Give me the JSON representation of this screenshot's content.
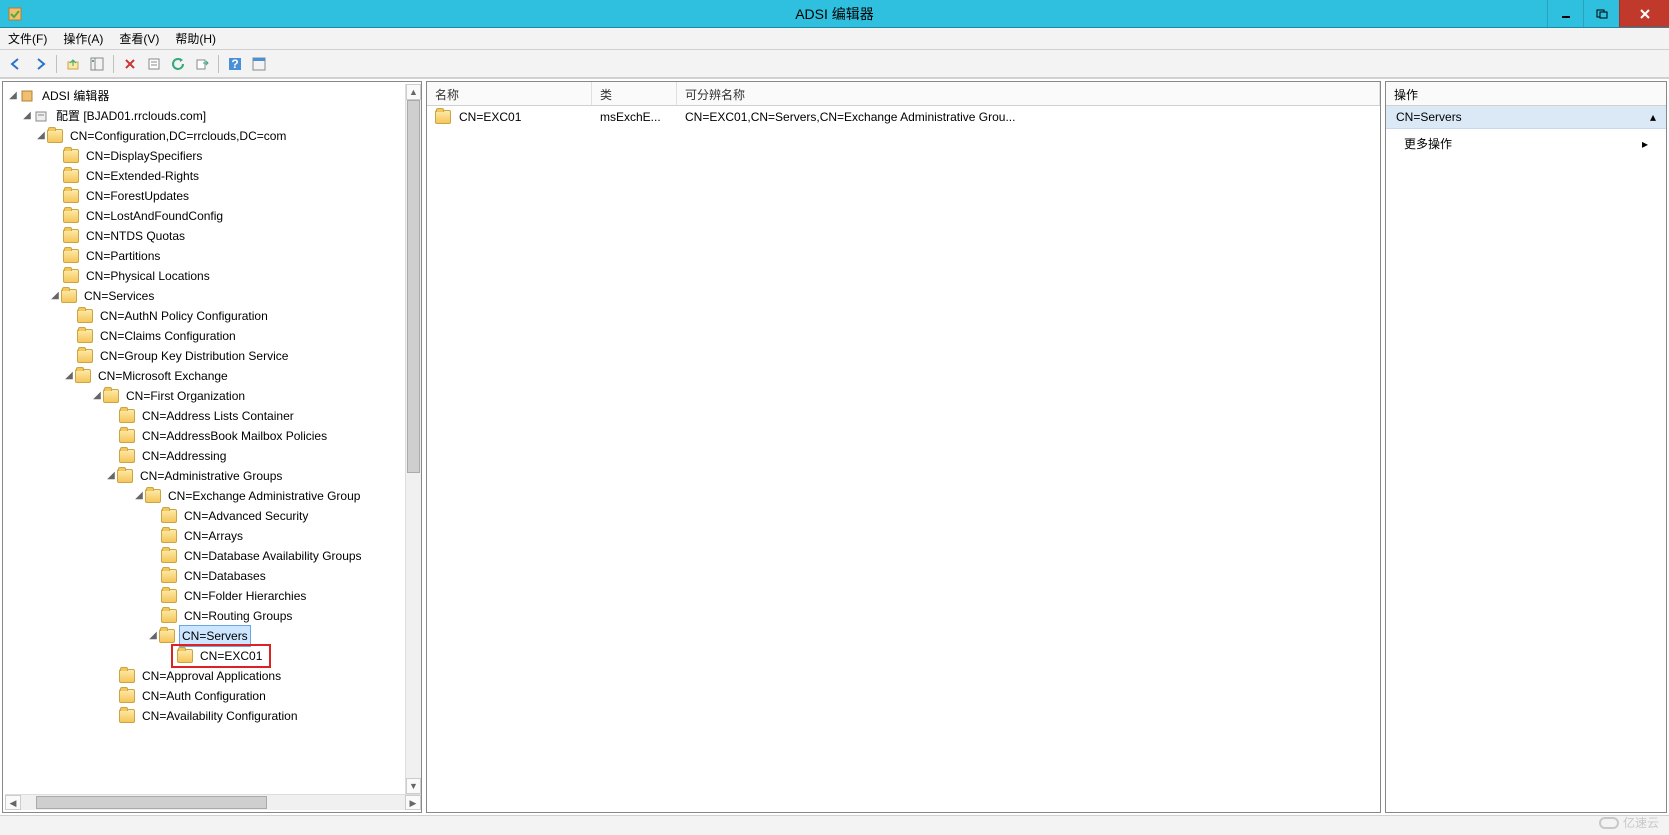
{
  "window": {
    "title": "ADSI 编辑器"
  },
  "menu": {
    "file": "文件(F)",
    "action": "操作(A)",
    "view": "查看(V)",
    "help": "帮助(H)"
  },
  "toolbar_icons": {
    "back": "back-icon",
    "forward": "forward-icon",
    "up": "up-icon",
    "show_tree": "show-tree-icon",
    "delete": "delete-icon",
    "properties": "properties-icon",
    "refresh": "refresh-icon",
    "export": "export-icon",
    "help": "help-icon",
    "details": "details-icon"
  },
  "tree": {
    "root": "ADSI 编辑器",
    "config_node": "配置 [BJAD01.rrclouds.com]",
    "configuration": "CN=Configuration,DC=rrclouds,DC=com",
    "nodes": {
      "display_specifiers": "CN=DisplaySpecifiers",
      "extended_rights": "CN=Extended-Rights",
      "forest_updates": "CN=ForestUpdates",
      "lost_and_found": "CN=LostAndFoundConfig",
      "ntds_quotas": "CN=NTDS Quotas",
      "partitions": "CN=Partitions",
      "physical_locations": "CN=Physical Locations",
      "services": "CN=Services",
      "authn_policy": "CN=AuthN Policy Configuration",
      "claims_config": "CN=Claims Configuration",
      "group_key": "CN=Group Key Distribution Service",
      "ms_exchange": "CN=Microsoft Exchange",
      "first_org": "CN=First Organization",
      "addr_lists": "CN=Address Lists Container",
      "addr_book": "CN=AddressBook Mailbox Policies",
      "addressing": "CN=Addressing",
      "admin_groups": "CN=Administrative Groups",
      "ex_admin_group": "CN=Exchange Administrative Group",
      "adv_security": "CN=Advanced Security",
      "arrays": "CN=Arrays",
      "dag": "CN=Database Availability Groups",
      "databases": "CN=Databases",
      "folder_hier": "CN=Folder Hierarchies",
      "routing_groups": "CN=Routing Groups",
      "servers": "CN=Servers",
      "exc01": "CN=EXC01",
      "approval_apps": "CN=Approval Applications",
      "auth_config": "CN=Auth Configuration",
      "avail_config": "CN=Availability Configuration"
    }
  },
  "list": {
    "columns": {
      "name": "名称",
      "class": "类",
      "dn": "可分辨名称"
    },
    "rows": [
      {
        "name": "CN=EXC01",
        "class": "msExchE...",
        "dn": "CN=EXC01,CN=Servers,CN=Exchange Administrative Grou..."
      }
    ]
  },
  "actions": {
    "header": "操作",
    "section": "CN=Servers",
    "more": "更多操作"
  },
  "watermark": "亿速云"
}
